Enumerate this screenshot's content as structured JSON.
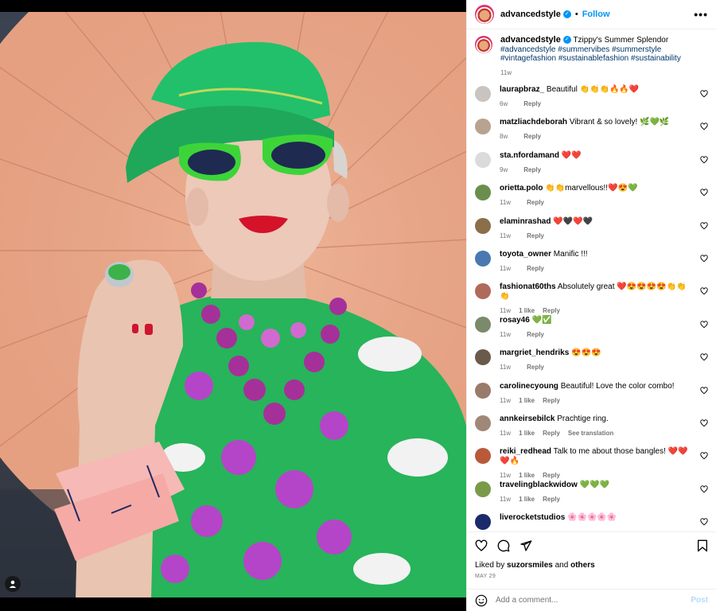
{
  "header": {
    "username": "advancedstyle",
    "separator": "•",
    "follow_label": "Follow",
    "more_label": "•••"
  },
  "caption": {
    "username": "advancedstyle",
    "text": "Tzippy's Summer Splendor",
    "hashtags": "#advancedstyle #summervibes #summerstyle #vintagefashion #sustainablefashion #sustainability",
    "time": "11w"
  },
  "comments": [
    {
      "user": "laurapbraz_",
      "text": "Beautiful 👏👏👏🔥🔥❤️",
      "time": "6w",
      "likes": "",
      "reply": "Reply",
      "extra": "",
      "avatar_color": "#c9c4c0"
    },
    {
      "user": "matzliachdeborah",
      "text": "Vibrant & so lovely! 🌿💚🌿",
      "time": "8w",
      "likes": "",
      "reply": "Reply",
      "extra": "",
      "avatar_color": "#b8a290"
    },
    {
      "user": "sta.nfordamand",
      "text": "❤️❤️",
      "time": "9w",
      "likes": "",
      "reply": "Reply",
      "extra": "",
      "avatar_color": "#dbdbdb"
    },
    {
      "user": "orietta.polo",
      "text": "👏👏marvellous!!❤️😍💚",
      "time": "11w",
      "likes": "",
      "reply": "Reply",
      "extra": "",
      "avatar_color": "#6b8e4e"
    },
    {
      "user": "elaminrashad",
      "text": "❤️🖤❤️🖤",
      "time": "11w",
      "likes": "",
      "reply": "Reply",
      "extra": "",
      "avatar_color": "#8a6f4a"
    },
    {
      "user": "toyota_owner",
      "text": "Manific !!!",
      "time": "11w",
      "likes": "",
      "reply": "Reply",
      "extra": "",
      "avatar_color": "#4a78b0"
    },
    {
      "user": "fashionat60ths",
      "text": "Absolutely great ❤️😍😍😍😍👏👏👏",
      "time": "11w",
      "likes": "1 like",
      "reply": "Reply",
      "extra": "",
      "avatar_color": "#b06a5a"
    },
    {
      "user": "rosay46",
      "text": "💚✅",
      "time": "11w",
      "likes": "",
      "reply": "Reply",
      "extra": "",
      "avatar_color": "#7a8a6a"
    },
    {
      "user": "margriet_hendriks",
      "text": "😍😍😍",
      "time": "11w",
      "likes": "",
      "reply": "Reply",
      "extra": "",
      "avatar_color": "#6a5a4a"
    },
    {
      "user": "carolinecyoung",
      "text": "Beautiful! Love the color combo!",
      "time": "11w",
      "likes": "1 like",
      "reply": "Reply",
      "extra": "",
      "avatar_color": "#9a7a6a"
    },
    {
      "user": "annkeirsebilck",
      "text": "Prachtige ring.",
      "time": "11w",
      "likes": "1 like",
      "reply": "Reply",
      "extra": "See translation",
      "avatar_color": "#a08878"
    },
    {
      "user": "reiki_redhead",
      "text": "Talk to me about those bangles! ❤️❤️❤️🔥",
      "time": "11w",
      "likes": "1 like",
      "reply": "Reply",
      "extra": "",
      "avatar_color": "#b85a3a"
    },
    {
      "user": "travelingblackwidow",
      "text": "💚💚💚",
      "time": "11w",
      "likes": "1 like",
      "reply": "Reply",
      "extra": "",
      "avatar_color": "#7a9a4a"
    },
    {
      "user": "liverocketstudios",
      "text": "🌸🌸🌸🌸🌸",
      "time": "",
      "likes": "",
      "reply": "",
      "extra": "",
      "avatar_color": "#1a2a6a"
    }
  ],
  "actions": {
    "liked_prefix": "Liked by",
    "liked_user": "suzorsmiles",
    "liked_and": "and",
    "liked_others": "others",
    "date": "MAY 29"
  },
  "add_comment": {
    "placeholder": "Add a comment...",
    "post_label": "Post"
  },
  "icons": {
    "tag": "user-tag-icon",
    "like": "heart-icon",
    "comment": "comment-icon",
    "share": "share-icon",
    "save": "bookmark-icon",
    "emoji": "emoji-icon"
  }
}
